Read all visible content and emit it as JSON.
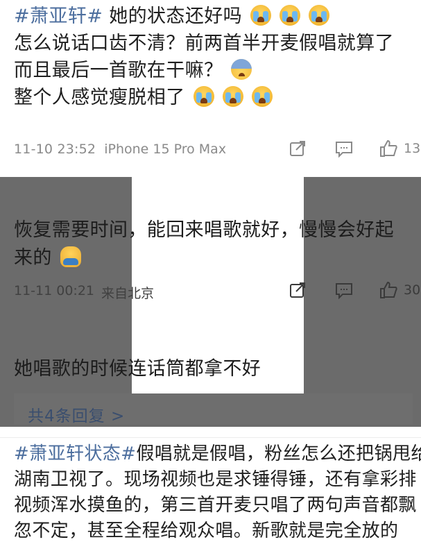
{
  "post1": {
    "tag": "#萧亚轩#",
    "line1_rest": " 她的状态还好吗",
    "line2": "怎么说话口齿不清？前两首半开麦假唱就算了",
    "line3": "而且最后一首歌在干嘛？",
    "line4": "整个人感觉瘦脱相了",
    "time": "11-10 23:52",
    "device": "iPhone 15 Pro Max",
    "like_count": "13"
  },
  "post2": {
    "line1": "恢复需要时间，能回来唱歌就好，慢慢会好起",
    "line2": "来的",
    "time": "11-11 00:21",
    "source": "来自北京",
    "like_count": "30"
  },
  "post3": {
    "text": "她唱歌的时候连话筒都拿不好",
    "replies": "共4条回复 >"
  },
  "post4": {
    "tag": "#萧亚轩状态#",
    "line1_rest": "假唱就是假唱，粉丝怎么还把锅甩给",
    "line2": "湖南卫视了。现场视频也是求锤得锤，还有拿彩排",
    "line3": "视频浑水摸鱼的，第三首开麦只唱了两句声音都飘",
    "line4": "忽不定，甚至全程给观众唱。新歌就是完全放的"
  },
  "icons": {
    "share": "share-icon",
    "comment": "comment-icon",
    "like": "thumbs-up-icon"
  }
}
